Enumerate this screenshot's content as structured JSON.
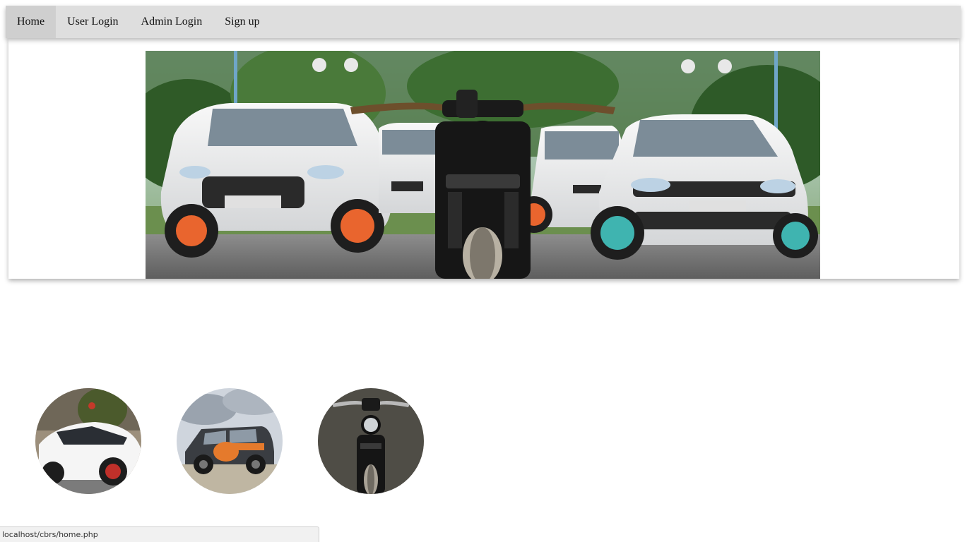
{
  "nav": {
    "items": [
      {
        "label": "Home",
        "active": true
      },
      {
        "label": "User Login",
        "active": false
      },
      {
        "label": "Admin Login",
        "active": false
      },
      {
        "label": "Sign up",
        "active": false
      }
    ]
  },
  "banner": {
    "image": "cars-and-motorcycle-photo"
  },
  "thumbnails": [
    {
      "image": "white-sedan-photo"
    },
    {
      "image": "dark-suv-photo"
    },
    {
      "image": "black-motorcycle-photo"
    }
  ],
  "status_bar": {
    "url": "localhost/cbrs/home.php"
  },
  "colors": {
    "nav_background": "#dedede",
    "nav_active": "#cfcfcf",
    "page_background": "#ffffff"
  }
}
